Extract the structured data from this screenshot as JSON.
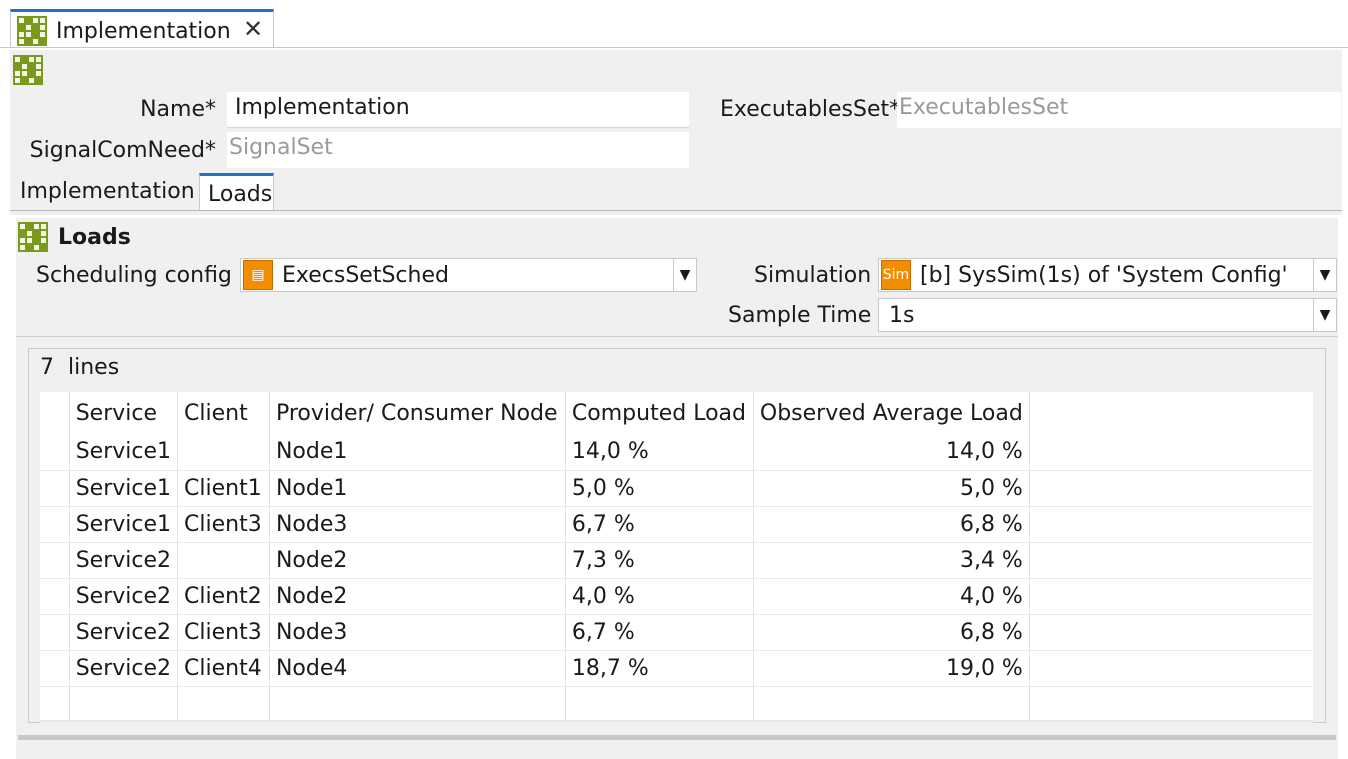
{
  "editor_tab": {
    "title": "Implementation",
    "close_glyph": "✕"
  },
  "form": {
    "name_label": "Name*",
    "name_value": "Implementation",
    "signal_label": "SignalComNeed*",
    "signal_placeholder": "SignalSet",
    "exec_label": "ExecutablesSet*",
    "exec_placeholder": "ExecutablesSet"
  },
  "tabs": [
    {
      "label": "Implementation",
      "active": false
    },
    {
      "label": "Loads",
      "active": true
    }
  ],
  "loads": {
    "title": "Loads",
    "scheduling_label": "Scheduling config",
    "scheduling_value": "ExecsSetSched",
    "scheduling_icon": "sched-icon",
    "simulation_label": "Simulation",
    "simulation_icon_text": "Sim",
    "simulation_value": "[b] SysSim(1s) of 'System Config'",
    "sample_label": "Sample Time",
    "sample_value": "1s",
    "dropdown_glyph": "▼"
  },
  "table": {
    "count": "7",
    "count_suffix": "lines",
    "columns": [
      "Service",
      "Client",
      "Provider/ Consumer Node",
      "Computed Load",
      "Observed Average Load"
    ],
    "rows": [
      [
        "Service1",
        "",
        "Node1",
        "14,0 %",
        "14,0 %"
      ],
      [
        "Service1",
        "Client1",
        "Node1",
        "5,0 %",
        "5,0 %"
      ],
      [
        "Service1",
        "Client3",
        "Node3",
        "6,7 %",
        "6,8 %"
      ],
      [
        "Service2",
        "",
        "Node2",
        "7,3 %",
        "3,4 %"
      ],
      [
        "Service2",
        "Client2",
        "Node2",
        "4,0 %",
        "4,0 %"
      ],
      [
        "Service2",
        "Client3",
        "Node3",
        "6,7 %",
        "6,8 %"
      ],
      [
        "Service2",
        "Client4",
        "Node4",
        "18,7 %",
        "19,0 %"
      ]
    ]
  },
  "colors": {
    "accent": "#1c73c9",
    "icon_green": "#7a9a1d",
    "icon_orange": "#f28c00"
  }
}
